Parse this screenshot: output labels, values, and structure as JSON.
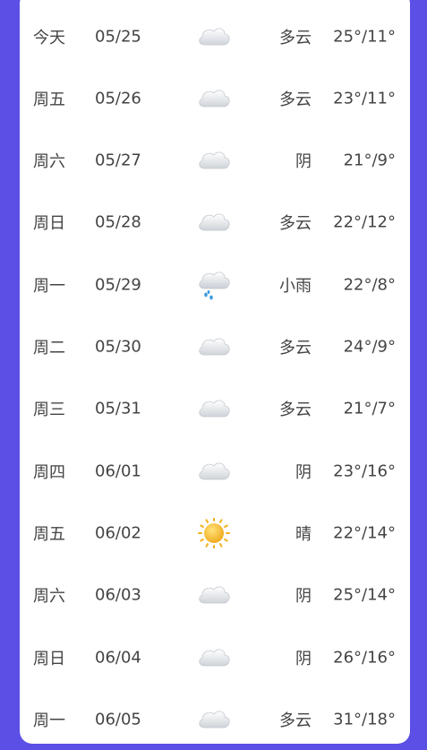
{
  "forecast": [
    {
      "day": "今天",
      "date": "05/25",
      "icon": "cloudy-icon",
      "condition": "多云",
      "temp": "25°/11°"
    },
    {
      "day": "周五",
      "date": "05/26",
      "icon": "cloudy-icon",
      "condition": "多云",
      "temp": "23°/11°"
    },
    {
      "day": "周六",
      "date": "05/27",
      "icon": "overcast-icon",
      "condition": "阴",
      "temp": "21°/9°"
    },
    {
      "day": "周日",
      "date": "05/28",
      "icon": "cloudy-icon",
      "condition": "多云",
      "temp": "22°/12°"
    },
    {
      "day": "周一",
      "date": "05/29",
      "icon": "light-rain-icon",
      "condition": "小雨",
      "temp": "22°/8°"
    },
    {
      "day": "周二",
      "date": "05/30",
      "icon": "cloudy-icon",
      "condition": "多云",
      "temp": "24°/9°"
    },
    {
      "day": "周三",
      "date": "05/31",
      "icon": "cloudy-icon",
      "condition": "多云",
      "temp": "21°/7°"
    },
    {
      "day": "周四",
      "date": "06/01",
      "icon": "overcast-icon",
      "condition": "阴",
      "temp": "23°/16°"
    },
    {
      "day": "周五",
      "date": "06/02",
      "icon": "sunny-icon",
      "condition": "晴",
      "temp": "22°/14°"
    },
    {
      "day": "周六",
      "date": "06/03",
      "icon": "overcast-icon",
      "condition": "阴",
      "temp": "25°/14°"
    },
    {
      "day": "周日",
      "date": "06/04",
      "icon": "overcast-icon",
      "condition": "阴",
      "temp": "26°/16°"
    },
    {
      "day": "周一",
      "date": "06/05",
      "icon": "cloudy-icon",
      "condition": "多云",
      "temp": "31°/18°"
    }
  ]
}
